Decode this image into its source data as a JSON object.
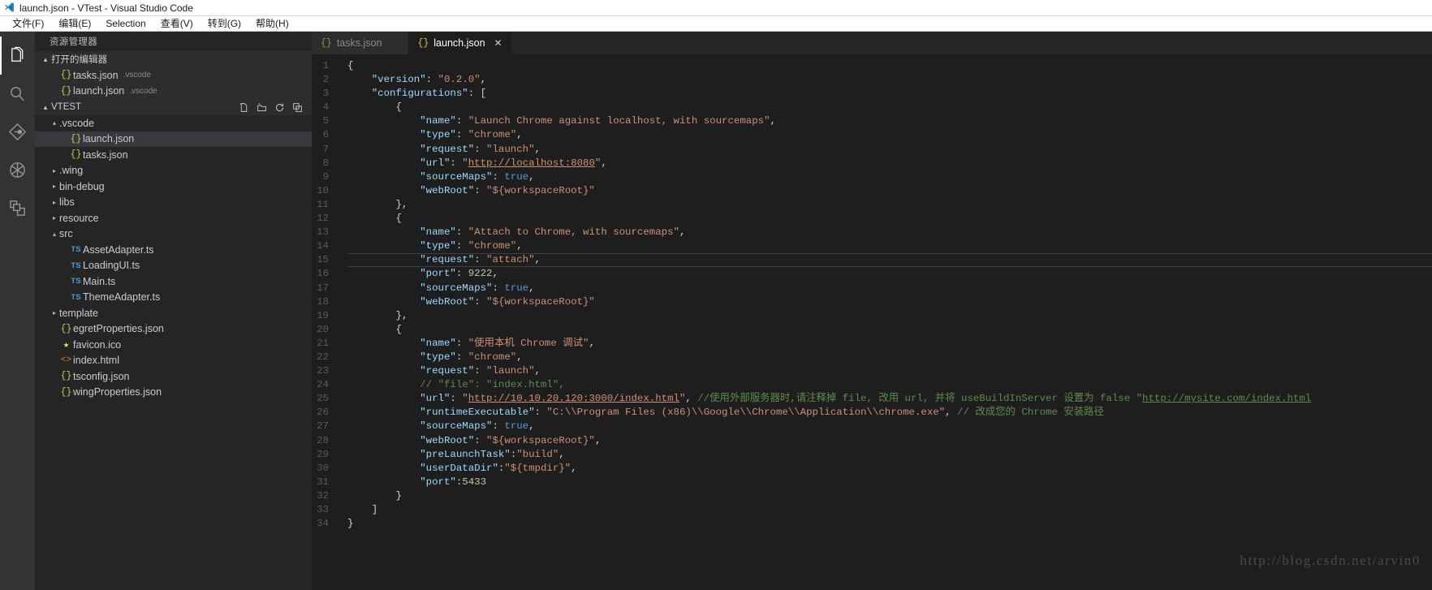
{
  "window": {
    "title": "launch.json - VTest - Visual Studio Code",
    "logo_icon": "vscode-logo-icon"
  },
  "menubar": {
    "items": [
      {
        "label": "文件(F)",
        "name": "menu-file"
      },
      {
        "label": "编辑(E)",
        "name": "menu-edit"
      },
      {
        "label": "Selection",
        "name": "menu-selection"
      },
      {
        "label": "查看(V)",
        "name": "menu-view"
      },
      {
        "label": "转到(G)",
        "name": "menu-goto"
      },
      {
        "label": "帮助(H)",
        "name": "menu-help"
      }
    ]
  },
  "activitybar": {
    "items": [
      {
        "name": "explorer-icon",
        "title": "资源管理器",
        "active": true
      },
      {
        "name": "search-icon",
        "title": "搜索",
        "active": false
      },
      {
        "name": "source-control-icon",
        "title": "源代码管理",
        "active": false
      },
      {
        "name": "debug-icon",
        "title": "调试",
        "active": false
      },
      {
        "name": "extensions-icon",
        "title": "扩展",
        "active": false
      }
    ]
  },
  "sidebar": {
    "title": "资源管理器",
    "open_editors": {
      "label": "打开的编辑器",
      "twisty": "▴",
      "files": [
        {
          "icon": "json-icon",
          "name": "tasks.json",
          "desc": ".vscode"
        },
        {
          "icon": "json-icon",
          "name": "launch.json",
          "desc": ".vscode"
        }
      ]
    },
    "workspace": {
      "label": "VTEST",
      "twisty": "▴",
      "actions": [
        "new-file-icon",
        "new-folder-icon",
        "refresh-icon",
        "collapse-all-icon"
      ],
      "tree": [
        {
          "indent": 1,
          "twisty": "▴",
          "icon": "folder",
          "name": ".vscode",
          "selected": false
        },
        {
          "indent": 2,
          "twisty": "",
          "icon": "json-icon",
          "name": "launch.json",
          "selected": true
        },
        {
          "indent": 2,
          "twisty": "",
          "icon": "json-icon",
          "name": "tasks.json",
          "selected": false
        },
        {
          "indent": 1,
          "twisty": "▸",
          "icon": "folder",
          "name": ".wing",
          "selected": false
        },
        {
          "indent": 1,
          "twisty": "▸",
          "icon": "folder",
          "name": "bin-debug",
          "selected": false
        },
        {
          "indent": 1,
          "twisty": "▸",
          "icon": "folder",
          "name": "libs",
          "selected": false
        },
        {
          "indent": 1,
          "twisty": "▸",
          "icon": "folder",
          "name": "resource",
          "selected": false
        },
        {
          "indent": 1,
          "twisty": "▴",
          "icon": "folder",
          "name": "src",
          "selected": false
        },
        {
          "indent": 2,
          "twisty": "",
          "icon": "ts-icon",
          "name": "AssetAdapter.ts",
          "selected": false
        },
        {
          "indent": 2,
          "twisty": "",
          "icon": "ts-icon",
          "name": "LoadingUI.ts",
          "selected": false
        },
        {
          "indent": 2,
          "twisty": "",
          "icon": "ts-icon",
          "name": "Main.ts",
          "selected": false
        },
        {
          "indent": 2,
          "twisty": "",
          "icon": "ts-icon",
          "name": "ThemeAdapter.ts",
          "selected": false
        },
        {
          "indent": 1,
          "twisty": "▸",
          "icon": "folder",
          "name": "template",
          "selected": false
        },
        {
          "indent": 1,
          "twisty": "",
          "icon": "json-icon",
          "name": "egretProperties.json",
          "selected": false
        },
        {
          "indent": 1,
          "twisty": "",
          "icon": "star-icon",
          "name": "favicon.ico",
          "selected": false
        },
        {
          "indent": 1,
          "twisty": "",
          "icon": "html-icon",
          "name": "index.html",
          "selected": false
        },
        {
          "indent": 1,
          "twisty": "",
          "icon": "json-icon",
          "name": "tsconfig.json",
          "selected": false
        },
        {
          "indent": 1,
          "twisty": "",
          "icon": "json-icon",
          "name": "wingProperties.json",
          "selected": false
        }
      ]
    }
  },
  "tabs": [
    {
      "icon": "{}",
      "label": "tasks.json",
      "active": false,
      "close": "✕"
    },
    {
      "icon": "{}",
      "label": "launch.json",
      "active": true,
      "close": "✕"
    }
  ],
  "editor": {
    "cursor_line": 15,
    "lines": [
      {
        "n": 1,
        "tokens": [
          {
            "t": "{",
            "c": "p"
          }
        ]
      },
      {
        "n": 2,
        "tokens": [
          {
            "t": "    ",
            "c": "p"
          },
          {
            "t": "\"version\"",
            "c": "k"
          },
          {
            "t": ": ",
            "c": "p"
          },
          {
            "t": "\"0.2.0\"",
            "c": "s"
          },
          {
            "t": ",",
            "c": "p"
          }
        ]
      },
      {
        "n": 3,
        "tokens": [
          {
            "t": "    ",
            "c": "p"
          },
          {
            "t": "\"configurations\"",
            "c": "k"
          },
          {
            "t": ": [",
            "c": "p"
          }
        ]
      },
      {
        "n": 4,
        "tokens": [
          {
            "t": "        {",
            "c": "p"
          }
        ]
      },
      {
        "n": 5,
        "tokens": [
          {
            "t": "            ",
            "c": "p"
          },
          {
            "t": "\"name\"",
            "c": "k"
          },
          {
            "t": ": ",
            "c": "p"
          },
          {
            "t": "\"Launch Chrome against localhost, with sourcemaps\"",
            "c": "s"
          },
          {
            "t": ",",
            "c": "p"
          }
        ]
      },
      {
        "n": 6,
        "tokens": [
          {
            "t": "            ",
            "c": "p"
          },
          {
            "t": "\"type\"",
            "c": "k"
          },
          {
            "t": ": ",
            "c": "p"
          },
          {
            "t": "\"chrome\"",
            "c": "s"
          },
          {
            "t": ",",
            "c": "p"
          }
        ]
      },
      {
        "n": 7,
        "tokens": [
          {
            "t": "            ",
            "c": "p"
          },
          {
            "t": "\"request\"",
            "c": "k"
          },
          {
            "t": ": ",
            "c": "p"
          },
          {
            "t": "\"launch\"",
            "c": "s"
          },
          {
            "t": ",",
            "c": "p"
          }
        ]
      },
      {
        "n": 8,
        "tokens": [
          {
            "t": "            ",
            "c": "p"
          },
          {
            "t": "\"url\"",
            "c": "k"
          },
          {
            "t": ": ",
            "c": "p"
          },
          {
            "t": "\"",
            "c": "s"
          },
          {
            "t": "http://localhost:8080",
            "c": "u"
          },
          {
            "t": "\"",
            "c": "s"
          },
          {
            "t": ",",
            "c": "p"
          }
        ]
      },
      {
        "n": 9,
        "tokens": [
          {
            "t": "            ",
            "c": "p"
          },
          {
            "t": "\"sourceMaps\"",
            "c": "k"
          },
          {
            "t": ": ",
            "c": "p"
          },
          {
            "t": "true",
            "c": "b"
          },
          {
            "t": ",",
            "c": "p"
          }
        ]
      },
      {
        "n": 10,
        "tokens": [
          {
            "t": "            ",
            "c": "p"
          },
          {
            "t": "\"webRoot\"",
            "c": "k"
          },
          {
            "t": ": ",
            "c": "p"
          },
          {
            "t": "\"${workspaceRoot}\"",
            "c": "s"
          }
        ]
      },
      {
        "n": 11,
        "tokens": [
          {
            "t": "        },",
            "c": "p"
          }
        ]
      },
      {
        "n": 12,
        "tokens": [
          {
            "t": "        {",
            "c": "p"
          }
        ]
      },
      {
        "n": 13,
        "tokens": [
          {
            "t": "            ",
            "c": "p"
          },
          {
            "t": "\"name\"",
            "c": "k"
          },
          {
            "t": ": ",
            "c": "p"
          },
          {
            "t": "\"Attach to Chrome, with sourcemaps\"",
            "c": "s"
          },
          {
            "t": ",",
            "c": "p"
          }
        ]
      },
      {
        "n": 14,
        "tokens": [
          {
            "t": "            ",
            "c": "p"
          },
          {
            "t": "\"type\"",
            "c": "k"
          },
          {
            "t": ": ",
            "c": "p"
          },
          {
            "t": "\"chrome\"",
            "c": "s"
          },
          {
            "t": ",",
            "c": "p"
          }
        ]
      },
      {
        "n": 15,
        "tokens": [
          {
            "t": "            ",
            "c": "p"
          },
          {
            "t": "\"request\"",
            "c": "k"
          },
          {
            "t": ": ",
            "c": "p"
          },
          {
            "t": "\"attach\"",
            "c": "s"
          },
          {
            "t": ",",
            "c": "p"
          }
        ]
      },
      {
        "n": 16,
        "tokens": [
          {
            "t": "            ",
            "c": "p"
          },
          {
            "t": "\"port\"",
            "c": "k"
          },
          {
            "t": ": ",
            "c": "p"
          },
          {
            "t": "9222",
            "c": "n"
          },
          {
            "t": ",",
            "c": "p"
          }
        ]
      },
      {
        "n": 17,
        "tokens": [
          {
            "t": "            ",
            "c": "p"
          },
          {
            "t": "\"sourceMaps\"",
            "c": "k"
          },
          {
            "t": ": ",
            "c": "p"
          },
          {
            "t": "true",
            "c": "b"
          },
          {
            "t": ",",
            "c": "p"
          }
        ]
      },
      {
        "n": 18,
        "tokens": [
          {
            "t": "            ",
            "c": "p"
          },
          {
            "t": "\"webRoot\"",
            "c": "k"
          },
          {
            "t": ": ",
            "c": "p"
          },
          {
            "t": "\"${workspaceRoot}\"",
            "c": "s"
          }
        ]
      },
      {
        "n": 19,
        "tokens": [
          {
            "t": "        },",
            "c": "p"
          }
        ]
      },
      {
        "n": 20,
        "tokens": [
          {
            "t": "        {",
            "c": "p"
          }
        ]
      },
      {
        "n": 21,
        "tokens": [
          {
            "t": "            ",
            "c": "p"
          },
          {
            "t": "\"name\"",
            "c": "k"
          },
          {
            "t": ": ",
            "c": "p"
          },
          {
            "t": "\"使用本机 Chrome 调试\"",
            "c": "s"
          },
          {
            "t": ",",
            "c": "p"
          }
        ]
      },
      {
        "n": 22,
        "tokens": [
          {
            "t": "            ",
            "c": "p"
          },
          {
            "t": "\"type\"",
            "c": "k"
          },
          {
            "t": ": ",
            "c": "p"
          },
          {
            "t": "\"chrome\"",
            "c": "s"
          },
          {
            "t": ",",
            "c": "p"
          }
        ]
      },
      {
        "n": 23,
        "tokens": [
          {
            "t": "            ",
            "c": "p"
          },
          {
            "t": "\"request\"",
            "c": "k"
          },
          {
            "t": ": ",
            "c": "p"
          },
          {
            "t": "\"launch\"",
            "c": "s"
          },
          {
            "t": ",",
            "c": "p"
          }
        ]
      },
      {
        "n": 24,
        "tokens": [
          {
            "t": "            ",
            "c": "p"
          },
          {
            "t": "// \"file\": \"index.html\",",
            "c": "c"
          }
        ]
      },
      {
        "n": 25,
        "tokens": [
          {
            "t": "            ",
            "c": "p"
          },
          {
            "t": "\"url\"",
            "c": "k"
          },
          {
            "t": ": ",
            "c": "p"
          },
          {
            "t": "\"",
            "c": "s"
          },
          {
            "t": "http://10.10.20.120:3000/index.html",
            "c": "u"
          },
          {
            "t": "\"",
            "c": "s"
          },
          {
            "t": ", ",
            "c": "p"
          },
          {
            "t": "//使用外部服务器时,请注释掉 file, 改用 url, 并将 useBuildInServer 设置为 false \"",
            "c": "c"
          },
          {
            "t": "http://mysite.com/index.html",
            "c": "ug"
          }
        ]
      },
      {
        "n": 26,
        "tokens": [
          {
            "t": "            ",
            "c": "p"
          },
          {
            "t": "\"runtimeExecutable\"",
            "c": "k"
          },
          {
            "t": ": ",
            "c": "p"
          },
          {
            "t": "\"C:\\\\Program Files (x86)\\\\Google\\\\Chrome\\\\Application\\\\chrome.exe\"",
            "c": "s"
          },
          {
            "t": ", ",
            "c": "p"
          },
          {
            "t": "// 改成您的 Chrome 安装路径",
            "c": "c"
          }
        ]
      },
      {
        "n": 27,
        "tokens": [
          {
            "t": "            ",
            "c": "p"
          },
          {
            "t": "\"sourceMaps\"",
            "c": "k"
          },
          {
            "t": ": ",
            "c": "p"
          },
          {
            "t": "true",
            "c": "b"
          },
          {
            "t": ",",
            "c": "p"
          }
        ]
      },
      {
        "n": 28,
        "tokens": [
          {
            "t": "            ",
            "c": "p"
          },
          {
            "t": "\"webRoot\"",
            "c": "k"
          },
          {
            "t": ": ",
            "c": "p"
          },
          {
            "t": "\"${workspaceRoot}\"",
            "c": "s"
          },
          {
            "t": ",",
            "c": "p"
          }
        ]
      },
      {
        "n": 29,
        "tokens": [
          {
            "t": "            ",
            "c": "p"
          },
          {
            "t": "\"preLaunchTask\"",
            "c": "k"
          },
          {
            "t": ":",
            "c": "p"
          },
          {
            "t": "\"build\"",
            "c": "s"
          },
          {
            "t": ",",
            "c": "p"
          }
        ]
      },
      {
        "n": 30,
        "tokens": [
          {
            "t": "            ",
            "c": "p"
          },
          {
            "t": "\"userDataDir\"",
            "c": "k"
          },
          {
            "t": ":",
            "c": "p"
          },
          {
            "t": "\"${tmpdir}\"",
            "c": "s"
          },
          {
            "t": ",",
            "c": "p"
          }
        ]
      },
      {
        "n": 31,
        "tokens": [
          {
            "t": "            ",
            "c": "p"
          },
          {
            "t": "\"port\"",
            "c": "k"
          },
          {
            "t": ":",
            "c": "p"
          },
          {
            "t": "5433",
            "c": "n"
          }
        ]
      },
      {
        "n": 32,
        "tokens": [
          {
            "t": "        }",
            "c": "p"
          }
        ]
      },
      {
        "n": 33,
        "tokens": [
          {
            "t": "    ]",
            "c": "p"
          }
        ]
      },
      {
        "n": 34,
        "tokens": [
          {
            "t": "}",
            "c": "p"
          }
        ]
      }
    ]
  },
  "watermark": "http://blog.csdn.net/arvin0"
}
